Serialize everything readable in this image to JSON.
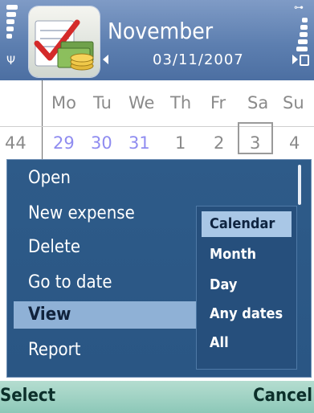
{
  "header": {
    "title": "November",
    "date": "03/11/2007"
  },
  "calendar": {
    "weekdays": [
      "Mo",
      "Tu",
      "We",
      "Th",
      "Fr",
      "Sa",
      "Su"
    ],
    "week_number": "44",
    "days": [
      "29",
      "30",
      "31",
      "1",
      "2",
      "3",
      "4"
    ],
    "selected_day": "3"
  },
  "menu": {
    "items": [
      "Open",
      "New expense",
      "Delete",
      "Go to date",
      "View",
      "Report"
    ],
    "highlighted": "View"
  },
  "submenu": {
    "items": [
      "Calendar",
      "Month",
      "Day",
      "Any dates",
      "All"
    ],
    "highlighted": "Calendar"
  },
  "softkeys": {
    "left": "Select",
    "right": "Cancel"
  },
  "colors": {
    "header_bg": "#5d7fb0",
    "menu_bg": "#2e5b89",
    "highlight": "#8fb1d6",
    "prev_month_day": "#8f8cf0",
    "softkey_bg": "#a6d6c8"
  },
  "icons": [
    "signal-strength-icon",
    "antenna-icon",
    "battery-icon",
    "usb-icon",
    "lock-icon",
    "expense-app-icon",
    "arrow-left-icon",
    "arrow-right-icon"
  ]
}
